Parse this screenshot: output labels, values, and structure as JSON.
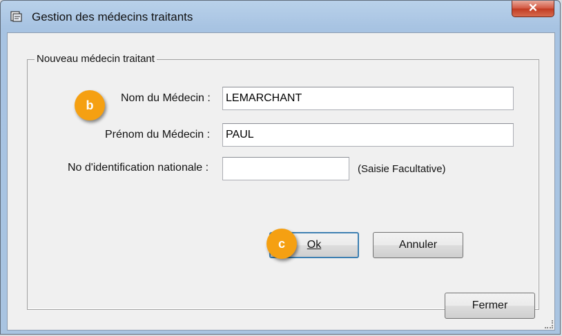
{
  "window": {
    "title": "Gestion des médecins traitants",
    "close_symbol": "✕"
  },
  "group": {
    "legend": "Nouveau médecin traitant"
  },
  "form": {
    "nom_label": "Nom du Médecin :",
    "nom_value": "LEMARCHANT",
    "prenom_label": "Prénom du Médecin :",
    "prenom_value": "PAUL",
    "id_label": "No d'identification nationale :",
    "id_value": "",
    "id_hint": "(Saisie Facultative)"
  },
  "buttons": {
    "ok": "Ok",
    "annuler": "Annuler",
    "fermer": "Fermer"
  },
  "callouts": {
    "b": "b",
    "c": "c"
  },
  "colors": {
    "callout": "#f5a012",
    "title_bar": "#b9d1ea",
    "close_button": "#c13b22"
  }
}
